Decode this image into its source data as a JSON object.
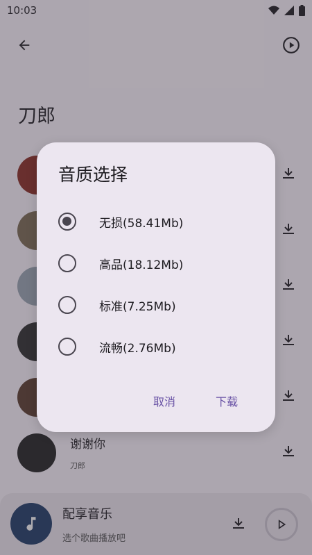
{
  "status_bar": {
    "time": "10:03"
  },
  "header": {
    "title": "刀郎"
  },
  "songs": [
    {
      "name": "",
      "subtitle": "",
      "art_color": "#8a2a22"
    },
    {
      "name": "",
      "subtitle": "",
      "art_color": "#7a6a52"
    },
    {
      "name": "",
      "subtitle": "",
      "art_color": "#9aa6b4"
    },
    {
      "name": "",
      "subtitle": "",
      "art_color": "#2b2b2b"
    },
    {
      "name": "",
      "subtitle": "",
      "art_color": "#5a3b2c"
    },
    {
      "name": "谢谢你",
      "subtitle": "刀郎",
      "art_color": "#1f1f1f"
    }
  ],
  "mini_player": {
    "title": "配享音乐",
    "subtitle": "选个歌曲播放吧"
  },
  "dialog": {
    "title": "音质选择",
    "options": [
      {
        "label": "无损(58.41Mb)",
        "selected": true
      },
      {
        "label": "高品(18.12Mb)",
        "selected": false
      },
      {
        "label": "标准(7.25Mb)",
        "selected": false
      },
      {
        "label": "流畅(2.76Mb)",
        "selected": false
      }
    ],
    "cancel_label": "取消",
    "confirm_label": "下载"
  },
  "colors": {
    "accent": "#6750a4",
    "surface": "#ece6f0",
    "background": "#fef7ff"
  }
}
